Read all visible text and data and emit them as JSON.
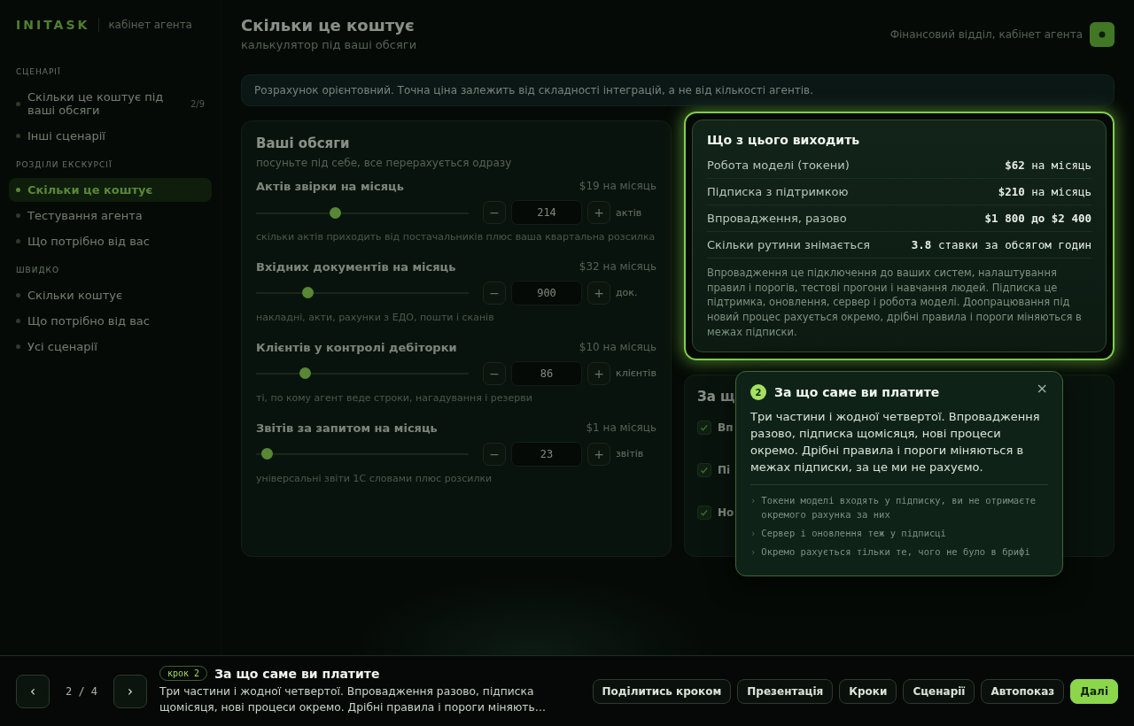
{
  "sidebar": {
    "logo": "INITASK",
    "subtitle": "кабінет агента",
    "sections": [
      {
        "heading": "СЦЕНАРІЇ",
        "items": [
          {
            "label": "Скільки це коштує під ваші обсяги",
            "count": "2/9",
            "selected": false
          },
          {
            "label": "Інші сценарії",
            "selected": false
          }
        ]
      },
      {
        "heading": "РОЗДІЛИ ЕКСКУРСІЇ",
        "items": [
          {
            "label": "Скільки це коштує",
            "selected": true
          },
          {
            "label": "Тестування агента",
            "selected": false
          },
          {
            "label": "Що потрібно від вас",
            "selected": false
          }
        ]
      },
      {
        "heading": "ШВИДКО",
        "items": [
          {
            "label": "Скільки коштує",
            "selected": false
          },
          {
            "label": "Що потрібно від вас",
            "selected": false
          },
          {
            "label": "Усі сценарії",
            "selected": false
          }
        ]
      }
    ]
  },
  "header": {
    "title": "Скільки це коштує",
    "subtitle": "калькулятор під ваші обсяги",
    "context": "Фінансовий відділ, кабінет агента"
  },
  "notice": "Розрахунок орієнтовний. Точна ціна залежить від складності інтеграцій, а не від кількості агентів.",
  "calculator": {
    "title": "Ваші обсяги",
    "subtitle": "посуньте під себе, все перерахується одразу",
    "inputs": [
      {
        "label": "Актів звірки на місяць",
        "cost": "$19 на місяць",
        "level": 0.37,
        "value": "214",
        "unit": "актів",
        "minus": "−",
        "plus": "+",
        "hint": "скільки актів приходить від постачальників плюс ваша квартальна розсилка"
      },
      {
        "label": "Вхідних документів на місяць",
        "cost": "$32 на місяць",
        "level": 0.24,
        "value": "900",
        "unit": "док.",
        "minus": "−",
        "plus": "+",
        "hint": "накладні, акти, рахунки з ЕДО, пошти і сканів"
      },
      {
        "label": "Клієнтів у контролі дебіторки",
        "cost": "$10 на місяць",
        "level": 0.23,
        "value": "86",
        "unit": "клієнтів",
        "minus": "−",
        "plus": "+",
        "hint": "ті, по кому агент веде строки, нагадування і резерви"
      },
      {
        "label": "Звітів за запитом на місяць",
        "cost": "$1 на місяць",
        "level": 0.05,
        "value": "23",
        "unit": "звітів",
        "minus": "−",
        "plus": "+",
        "hint": "універсальні звіти 1С словами плюс розсилки"
      }
    ]
  },
  "result": {
    "highlighted": true,
    "title": "Що з цього виходить",
    "rows": [
      {
        "label": "Робота моделі (токени)",
        "amount": "$62",
        "rest": "на місяць"
      },
      {
        "label": "Підписка з підтримкою",
        "amount": "$210",
        "rest": "на місяць"
      },
      {
        "label": "Впровадження, разово",
        "amount": "$1 800 до $2 400"
      },
      {
        "label": "Скільки рутини знімається",
        "amount": "3.8",
        "rest": "ставки за обсягом годин"
      }
    ],
    "note": "Впровадження це підключення до ваших систем, налаштування правил і порогів, тестові прогони і навчання людей. Підписка це підтримка, оновлення, сервер і робота моделі. Доопрацювання під новий процес рахується окремо, дрібні правила і пороги міняються в межах підписки."
  },
  "coverage": {
    "title": "За щ",
    "items": [
      {
        "text": "Вп"
      },
      {
        "text": "Пі"
      },
      {
        "text": "Но"
      }
    ]
  },
  "popup": {
    "step": "2",
    "title": "За що саме ви платите",
    "close": "×",
    "body": "Три частини і жодної четвертої. Впровадження разово, підписка щомісяця, нові процеси окремо. Дрібні правила і пороги міняються в межах підписки, за це ми не рахуємо.",
    "points": [
      {
        "marker": "›",
        "text": "Токени моделі входять у підписку, ви не отримаєте окремого рахунка за них"
      },
      {
        "marker": "›",
        "text": "Сервер і оновлення теж у підписці"
      },
      {
        "marker": "›",
        "text": "Окремо рахується тільки те, чого не було в брифі"
      }
    ]
  },
  "tour": {
    "prev": "‹",
    "counter": "2 / 4",
    "next": "›",
    "badge": "крок 2",
    "title": "За що саме ви платите",
    "description": "Три частини і жодної четвертої. Впровадження разово, підписка щомісяця, нові процеси окремо. Дрібні правила і пороги міняють…",
    "buttons": [
      {
        "label": "Поділитись кроком",
        "primary": false
      },
      {
        "label": "Презентація",
        "primary": false
      },
      {
        "label": "Кроки",
        "primary": false
      },
      {
        "label": "Сценарії",
        "primary": false
      },
      {
        "label": "Автопоказ",
        "primary": false
      },
      {
        "label": "Далі",
        "primary": true
      }
    ]
  }
}
